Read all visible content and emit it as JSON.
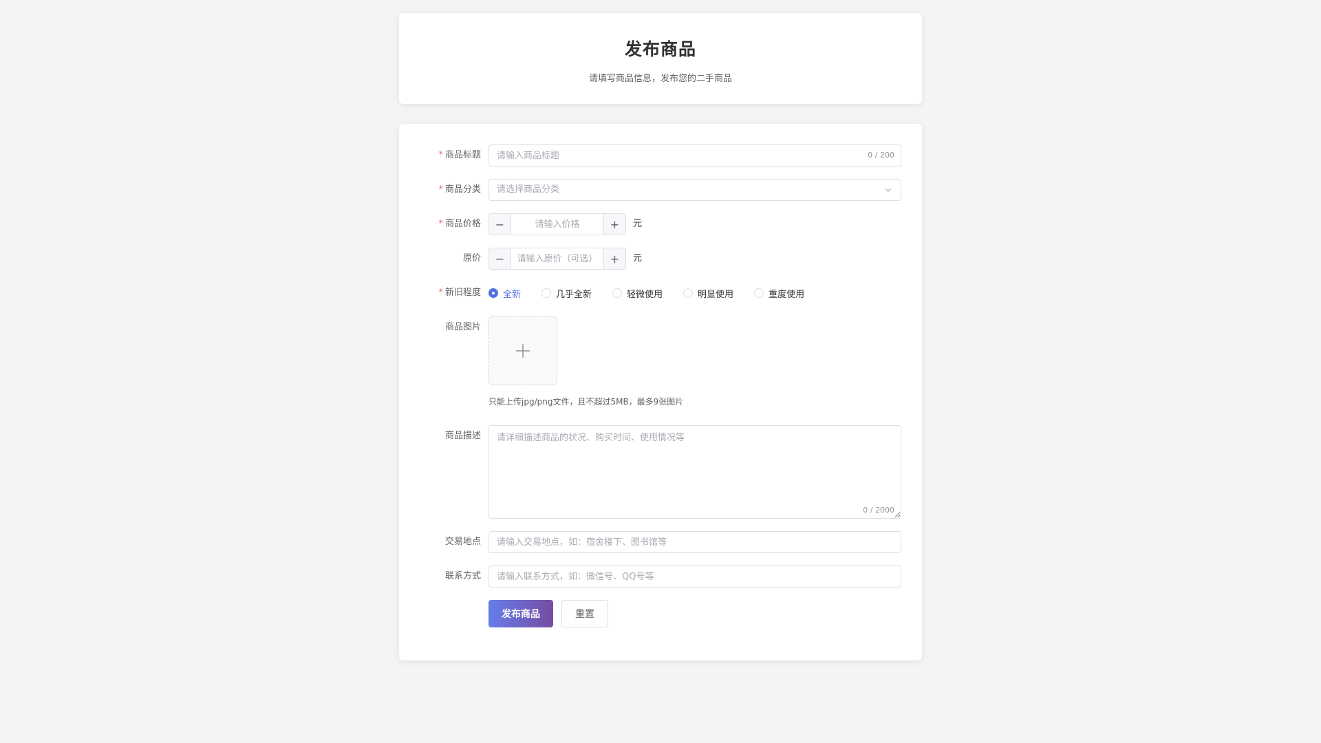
{
  "header": {
    "title": "发布商品",
    "subtitle": "请填写商品信息，发布您的二手商品"
  },
  "form": {
    "title_field": {
      "label": "商品标题",
      "required": true,
      "placeholder": "请输入商品标题",
      "value": "",
      "counter": "0 / 200"
    },
    "category_field": {
      "label": "商品分类",
      "required": true,
      "placeholder": "请选择商品分类",
      "icon": "chevron-down-icon"
    },
    "price_field": {
      "label": "商品价格",
      "required": true,
      "placeholder": "请输入价格",
      "unit": "元",
      "minus": "−",
      "plus": "+"
    },
    "original_price_field": {
      "label": "原价",
      "required": false,
      "placeholder": "请输入原价（可选）",
      "unit": "元",
      "minus": "−",
      "plus": "+"
    },
    "condition_field": {
      "label": "新旧程度",
      "required": true,
      "options": [
        "全新",
        "几乎全新",
        "轻微使用",
        "明显使用",
        "重度使用"
      ],
      "selected": "全新"
    },
    "images_field": {
      "label": "商品图片",
      "tip": "只能上传jpg/png文件，且不超过5MB，最多9张图片",
      "icon": "plus-icon"
    },
    "description_field": {
      "label": "商品描述",
      "placeholder": "请详细描述商品的状况、购买时间、使用情况等",
      "counter": "0 / 2000"
    },
    "location_field": {
      "label": "交易地点",
      "placeholder": "请输入交易地点，如：宿舍楼下、图书馆等"
    },
    "contact_field": {
      "label": "联系方式",
      "placeholder": "请输入联系方式，如：微信号、QQ号等"
    },
    "actions": {
      "submit": "发布商品",
      "reset": "重置"
    }
  },
  "colors": {
    "primary_gradient_start": "#667eea",
    "primary_gradient_end": "#764ba2",
    "radio_checked": "#5470e0",
    "required_star": "#f56c6c",
    "background": "#f4f4f5"
  }
}
